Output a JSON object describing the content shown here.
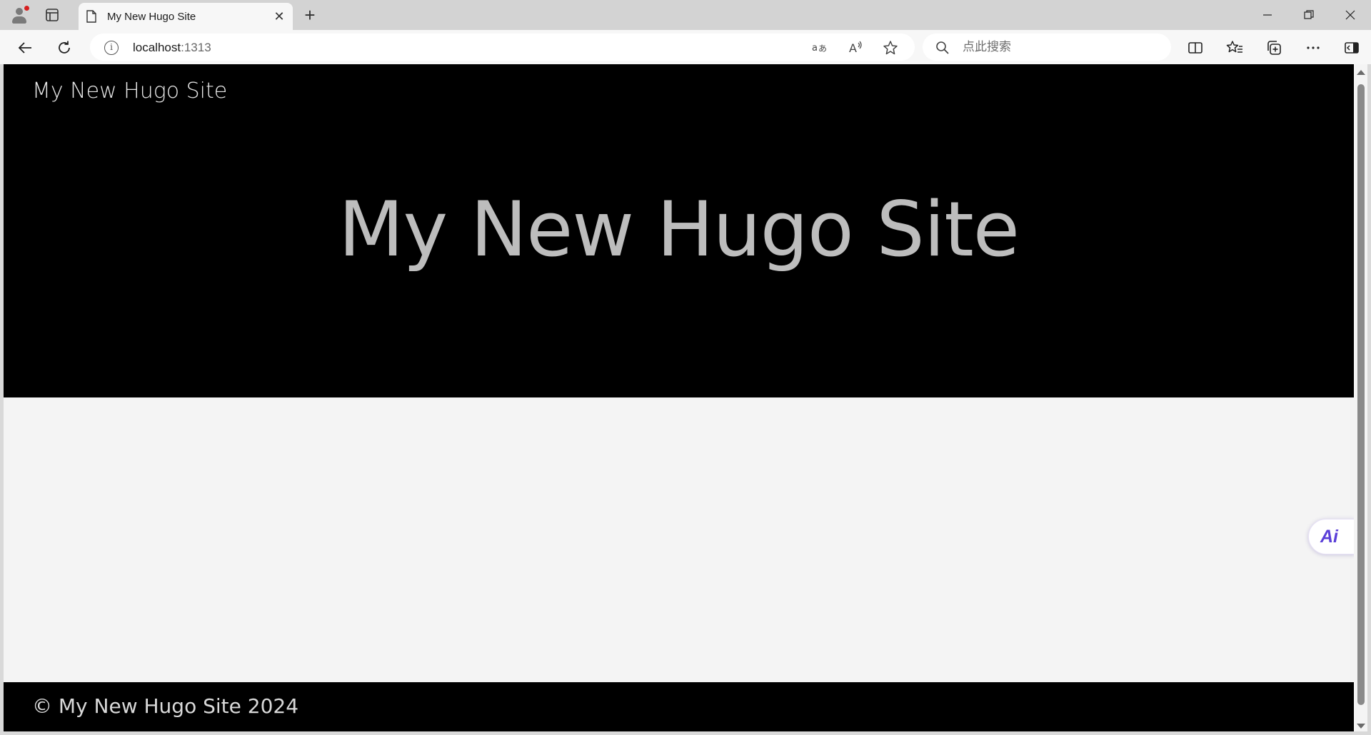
{
  "browser": {
    "tab": {
      "title": "My New Hugo Site",
      "close_glyph": "✕"
    },
    "new_tab_glyph": "+",
    "address": {
      "host": "localhost",
      "port": ":1313"
    },
    "search": {
      "placeholder": "点此搜索"
    },
    "icons": {
      "profile": "profile-icon",
      "tab_actions": "tab-actions-icon",
      "page": "page-icon",
      "back": "back-arrow-icon",
      "refresh": "refresh-icon",
      "info": "site-info-icon",
      "translate": "translate-icon",
      "read_aloud": "read-aloud-icon",
      "favorite": "star-icon",
      "split": "split-screen-icon",
      "favorites": "favorites-icon",
      "collections": "collections-icon",
      "more": "more-icon",
      "sidebar": "sidebar-icon"
    },
    "window": {
      "minimize": "—",
      "restore": "❐",
      "close": "✕"
    }
  },
  "page": {
    "logo": "My New Hugo Site",
    "hero_title": "My New Hugo Site",
    "footer": "© My New Hugo Site 2024",
    "ai_button": "Ai"
  },
  "colors": {
    "hero_bg": "#000000",
    "hero_title": "#bdbdbd",
    "body_bg": "#f4f4f4",
    "ai_accent": "#5a3fd8"
  }
}
